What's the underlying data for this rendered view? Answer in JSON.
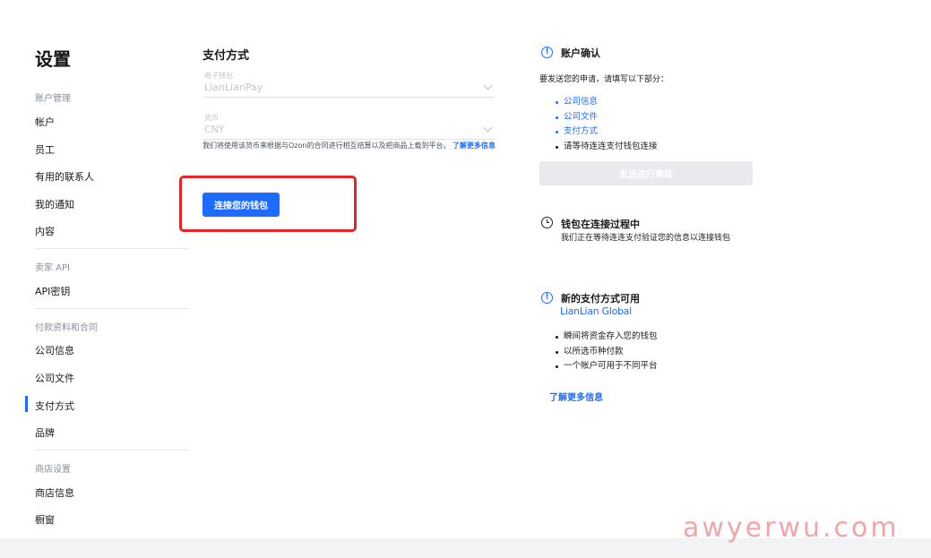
{
  "sidebar": {
    "title": "设置",
    "sections": [
      {
        "heading": "账户管理",
        "items": [
          "帐户",
          "员工",
          "有用的联系人",
          "我的通知",
          "内容"
        ]
      },
      {
        "heading": "卖家 API",
        "items": [
          "API密钥"
        ]
      },
      {
        "heading": "付款资料和合同",
        "items": [
          "公司信息",
          "公司文件",
          "支付方式",
          "品牌"
        ]
      },
      {
        "heading": "商店设置",
        "items": [
          "商店信息",
          "橱窗"
        ]
      }
    ],
    "active_item": "支付方式"
  },
  "main": {
    "title": "支付方式",
    "wallet_field": {
      "label": "电子钱包",
      "value": "LianLianPay"
    },
    "currency_field": {
      "label": "货币",
      "value": "CNY"
    },
    "note": "我们将使用该货币来根据与Ozon的合同进行相互结算以及把商品上载到平台。",
    "note_link": "了解更多信息",
    "connect_button": "连接您的钱包"
  },
  "right": {
    "account_confirm": {
      "title": "账户确认",
      "intro": "要发送您的申请，请填写以下部分：",
      "links": [
        "公司信息",
        "公司文件",
        "支付方式"
      ],
      "pending": "请等待连连支付钱包连接",
      "submit_button": "发送进行审核"
    },
    "wallet_connecting": {
      "title": "钱包在连接过程中",
      "text": "我们正在等待连连支付验证您的信息以连接钱包"
    },
    "new_method": {
      "title": "新的支付方式可用",
      "brand": "LianLian Global",
      "bullets": [
        "瞬间将资金存入您的钱包",
        "以所选币种付款",
        "一个帐户可用于不同平台"
      ],
      "learn_more": "了解更多信息"
    }
  },
  "watermark": "awyerwu.com",
  "colors": {
    "accent": "#1f6bff",
    "highlight": "#e8242a"
  },
  "icons": [
    "info-icon",
    "clock-icon",
    "chevron-down-icon"
  ]
}
